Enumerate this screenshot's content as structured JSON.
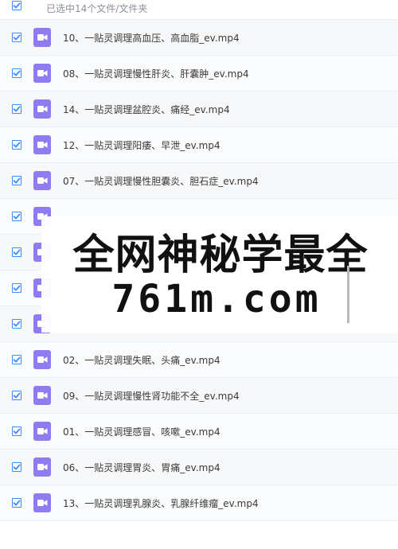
{
  "header": {
    "selection_text": "已选中14个文件/文件夹",
    "checked": true
  },
  "colors": {
    "accent": "#3b8cff",
    "video_icon": "#8e7cf0"
  },
  "files": [
    {
      "name": "10、一贴灵调理高血压、高血脂_ev.mp4",
      "icon": "video-file-icon",
      "checked": true
    },
    {
      "name": "08、一贴灵调理慢性肝炎、肝囊肿_ev.mp4",
      "icon": "video-file-icon",
      "checked": true
    },
    {
      "name": "14、一贴灵调理盆腔炎、痛经_ev.mp4",
      "icon": "video-file-icon",
      "checked": true
    },
    {
      "name": "12、一贴灵调理阳痿、早泄_ev.mp4",
      "icon": "video-file-icon",
      "checked": true
    },
    {
      "name": "07、一贴灵调理慢性胆囊炎、胆石症_ev.mp4",
      "icon": "video-file-icon",
      "checked": true
    },
    {
      "name": "",
      "icon": "video-file-icon",
      "checked": true
    },
    {
      "name": "",
      "icon": "video-file-icon",
      "checked": true
    },
    {
      "name": "",
      "icon": "video-file-icon",
      "checked": true
    },
    {
      "name": "",
      "icon": "video-file-icon",
      "checked": true
    },
    {
      "name": "02、一贴灵调理失眠、头痛_ev.mp4",
      "icon": "video-file-icon",
      "checked": true
    },
    {
      "name": "09、一贴灵调理慢性肾功能不全_ev.mp4",
      "icon": "video-file-icon",
      "checked": true
    },
    {
      "name": "01、一贴灵调理感冒、咳嗽_ev.mp4",
      "icon": "video-file-icon",
      "checked": true
    },
    {
      "name": "06、一贴灵调理胃炎、胃痛_ev.mp4",
      "icon": "video-file-icon",
      "checked": true
    },
    {
      "name": "13、一贴灵调理乳腺炎、乳腺纤维瘤_ev.mp4",
      "icon": "video-file-icon",
      "checked": true
    }
  ],
  "watermark": {
    "line1": "全网神秘学最全",
    "line2": "761m.com"
  }
}
